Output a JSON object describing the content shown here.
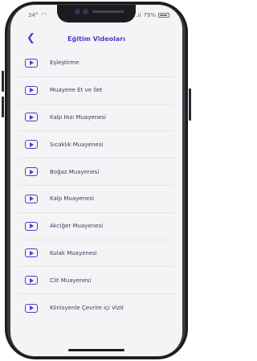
{
  "status_bar": {
    "time": "34°",
    "wifi_icon": "wifi-icon",
    "signal": ".ıl",
    "battery_percent": "79%"
  },
  "header": {
    "title": "Eğitim Videoları",
    "back_icon": "chevron-left-icon"
  },
  "videos": [
    {
      "label": "Eşleştirme"
    },
    {
      "label": "Muayene Et ve İlet"
    },
    {
      "label": "Kalp Hızı Muayenesi"
    },
    {
      "label": "Sıcaklık Muayenesi"
    },
    {
      "label": "Boğaz Muayenesi"
    },
    {
      "label": "Kalp Muayenesi"
    },
    {
      "label": "Akciğer Muayenesi"
    },
    {
      "label": "Kulak Muayenesi"
    },
    {
      "label": "Cilt Muayenesi"
    },
    {
      "label": "Klinisyenle Çevrim içi Vizit"
    }
  ],
  "colors": {
    "accent": "#4b3fc6",
    "background": "#f4f4f6",
    "text": "#3a3a5a"
  }
}
